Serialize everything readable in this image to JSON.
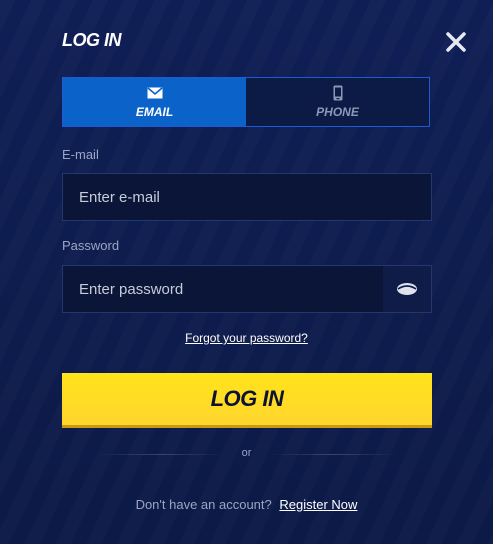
{
  "header": {
    "title": "LOG IN",
    "close_icon": "close-icon"
  },
  "tabs": [
    {
      "label": "EMAIL",
      "icon": "envelope-icon",
      "active": true
    },
    {
      "label": "PHONE",
      "icon": "phone-icon",
      "active": false
    }
  ],
  "email": {
    "label": "E-mail",
    "placeholder": "Enter e-mail",
    "value": ""
  },
  "password": {
    "label": "Password",
    "placeholder": "Enter password",
    "value": "",
    "toggle_icon": "eye-icon"
  },
  "forgot_link": "Forgot your password?",
  "login_button": "LOG IN",
  "divider_text": "or",
  "signup": {
    "prompt": "Don't have an account?",
    "link": "Register Now"
  },
  "colors": {
    "background": "#0d1b4a",
    "tab_active": "#0b63c9",
    "button": "#ffe41a",
    "button_text": "#0d1233"
  }
}
